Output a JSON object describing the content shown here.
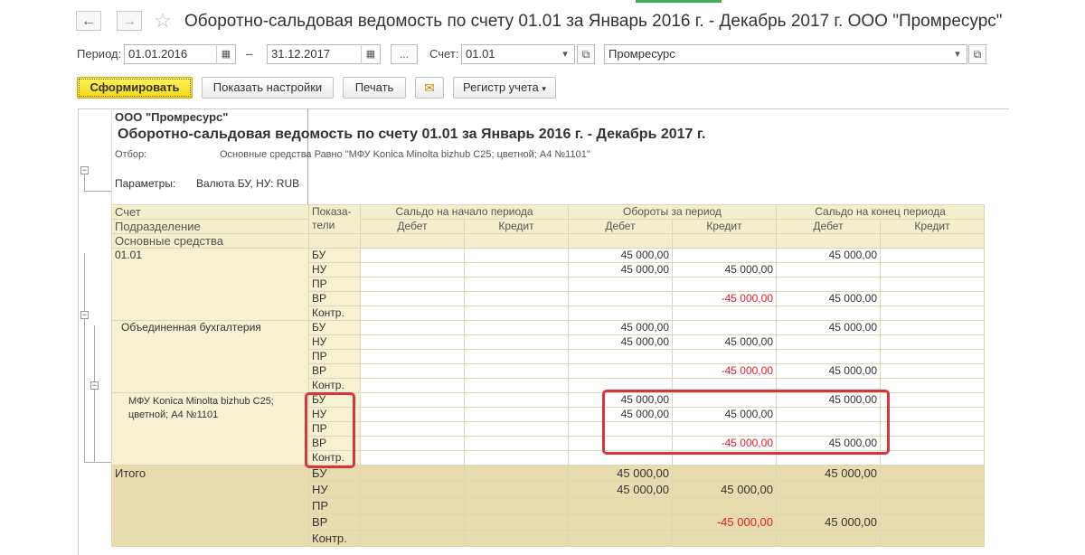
{
  "window": {
    "title": "Оборотно-сальдовая ведомость по счету 01.01 за Январь 2016 г. - Декабрь 2017 г. ООО \"Промресурс\"",
    "back_icon": "←",
    "forward_icon": "→",
    "star_icon": "☆"
  },
  "filters": {
    "period_label": "Период:",
    "date_from": "01.01.2016",
    "dash": "–",
    "date_to": "31.12.2017",
    "dots_label": "...",
    "account_label": "Счет:",
    "account_value": "01.01",
    "org_value": "Промресурс"
  },
  "toolbar": {
    "generate": "Сформировать",
    "settings": "Показать настройки",
    "print": "Печать",
    "register": "Регистр учета"
  },
  "report": {
    "org": "ООО \"Промресурс\"",
    "heading": "Оборотно-сальдовая ведомость по счету 01.01 за Январь 2016 г. - Декабрь 2017 г.",
    "filter_label": "Отбор:",
    "filter_value": "Основные средства Равно \"МФУ Konica Minolta bizhub C25; цветной; A4  №1101\"",
    "params_label": "Параметры:",
    "params_value": "Валюта БУ, НУ: RUB"
  },
  "table": {
    "head": {
      "col1_line1": "Счет",
      "col1_line2": "Подразделение",
      "col1_line3": "Основные средства",
      "ind_line1": "Показа-",
      "ind_line2": "тели",
      "saldo_start": "Сальдо на начало периода",
      "turnover": "Обороты за период",
      "saldo_end": "Сальдо на конец периода",
      "debit": "Дебет",
      "credit": "Кредит"
    },
    "groups": [
      {
        "name": "01.01",
        "rows": [
          {
            "ind": "БУ",
            "sd": "",
            "sc": "",
            "td": "45 000,00",
            "tc": "",
            "ed": "45 000,00",
            "ec": ""
          },
          {
            "ind": "НУ",
            "sd": "",
            "sc": "",
            "td": "45 000,00",
            "tc": "45 000,00",
            "ed": "",
            "ec": ""
          },
          {
            "ind": "ПР",
            "sd": "",
            "sc": "",
            "td": "",
            "tc": "",
            "ed": "",
            "ec": ""
          },
          {
            "ind": "ВР",
            "sd": "",
            "sc": "",
            "td": "",
            "tc": "-45 000,00",
            "ed": "45 000,00",
            "ec": ""
          },
          {
            "ind": "Контр.",
            "sd": "",
            "sc": "",
            "td": "",
            "tc": "",
            "ed": "",
            "ec": ""
          }
        ]
      },
      {
        "name": "Объединенная бухгалтерия",
        "rows": [
          {
            "ind": "БУ",
            "sd": "",
            "sc": "",
            "td": "45 000,00",
            "tc": "",
            "ed": "45 000,00",
            "ec": ""
          },
          {
            "ind": "НУ",
            "sd": "",
            "sc": "",
            "td": "45 000,00",
            "tc": "45 000,00",
            "ed": "",
            "ec": ""
          },
          {
            "ind": "ПР",
            "sd": "",
            "sc": "",
            "td": "",
            "tc": "",
            "ed": "",
            "ec": ""
          },
          {
            "ind": "ВР",
            "sd": "",
            "sc": "",
            "td": "",
            "tc": "-45 000,00",
            "ed": "45 000,00",
            "ec": ""
          },
          {
            "ind": "Контр.",
            "sd": "",
            "sc": "",
            "td": "",
            "tc": "",
            "ed": "",
            "ec": ""
          }
        ]
      },
      {
        "name_line1": "МФУ Konica Minolta bizhub C25;",
        "name_line2": "цветной; A4  №1101",
        "rows": [
          {
            "ind": "БУ",
            "sd": "",
            "sc": "",
            "td": "45 000,00",
            "tc": "",
            "ed": "45 000,00",
            "ec": ""
          },
          {
            "ind": "НУ",
            "sd": "",
            "sc": "",
            "td": "45 000,00",
            "tc": "45 000,00",
            "ed": "",
            "ec": ""
          },
          {
            "ind": "ПР",
            "sd": "",
            "sc": "",
            "td": "",
            "tc": "",
            "ed": "",
            "ec": ""
          },
          {
            "ind": "ВР",
            "sd": "",
            "sc": "",
            "td": "",
            "tc": "-45 000,00",
            "ed": "45 000,00",
            "ec": ""
          },
          {
            "ind": "Контр.",
            "sd": "",
            "sc": "",
            "td": "",
            "tc": "",
            "ed": "",
            "ec": ""
          }
        ]
      }
    ],
    "total": {
      "name": "Итого",
      "rows": [
        {
          "ind": "БУ",
          "sd": "",
          "sc": "",
          "td": "45 000,00",
          "tc": "",
          "ed": "45 000,00",
          "ec": ""
        },
        {
          "ind": "НУ",
          "sd": "",
          "sc": "",
          "td": "45 000,00",
          "tc": "45 000,00",
          "ed": "",
          "ec": ""
        },
        {
          "ind": "ПР",
          "sd": "",
          "sc": "",
          "td": "",
          "tc": "",
          "ed": "",
          "ec": ""
        },
        {
          "ind": "ВР",
          "sd": "",
          "sc": "",
          "td": "",
          "tc": "-45 000,00",
          "ed": "45 000,00",
          "ec": ""
        },
        {
          "ind": "Контр.",
          "sd": "",
          "sc": "",
          "td": "",
          "tc": "",
          "ed": "",
          "ec": ""
        }
      ]
    }
  },
  "colors": {
    "accent_yellow": "#f4d91a",
    "highlight_red": "#d9343a",
    "negative_red": "#e02020",
    "header_bg": "#f3eecb",
    "total_bg": "#e8dcae"
  }
}
